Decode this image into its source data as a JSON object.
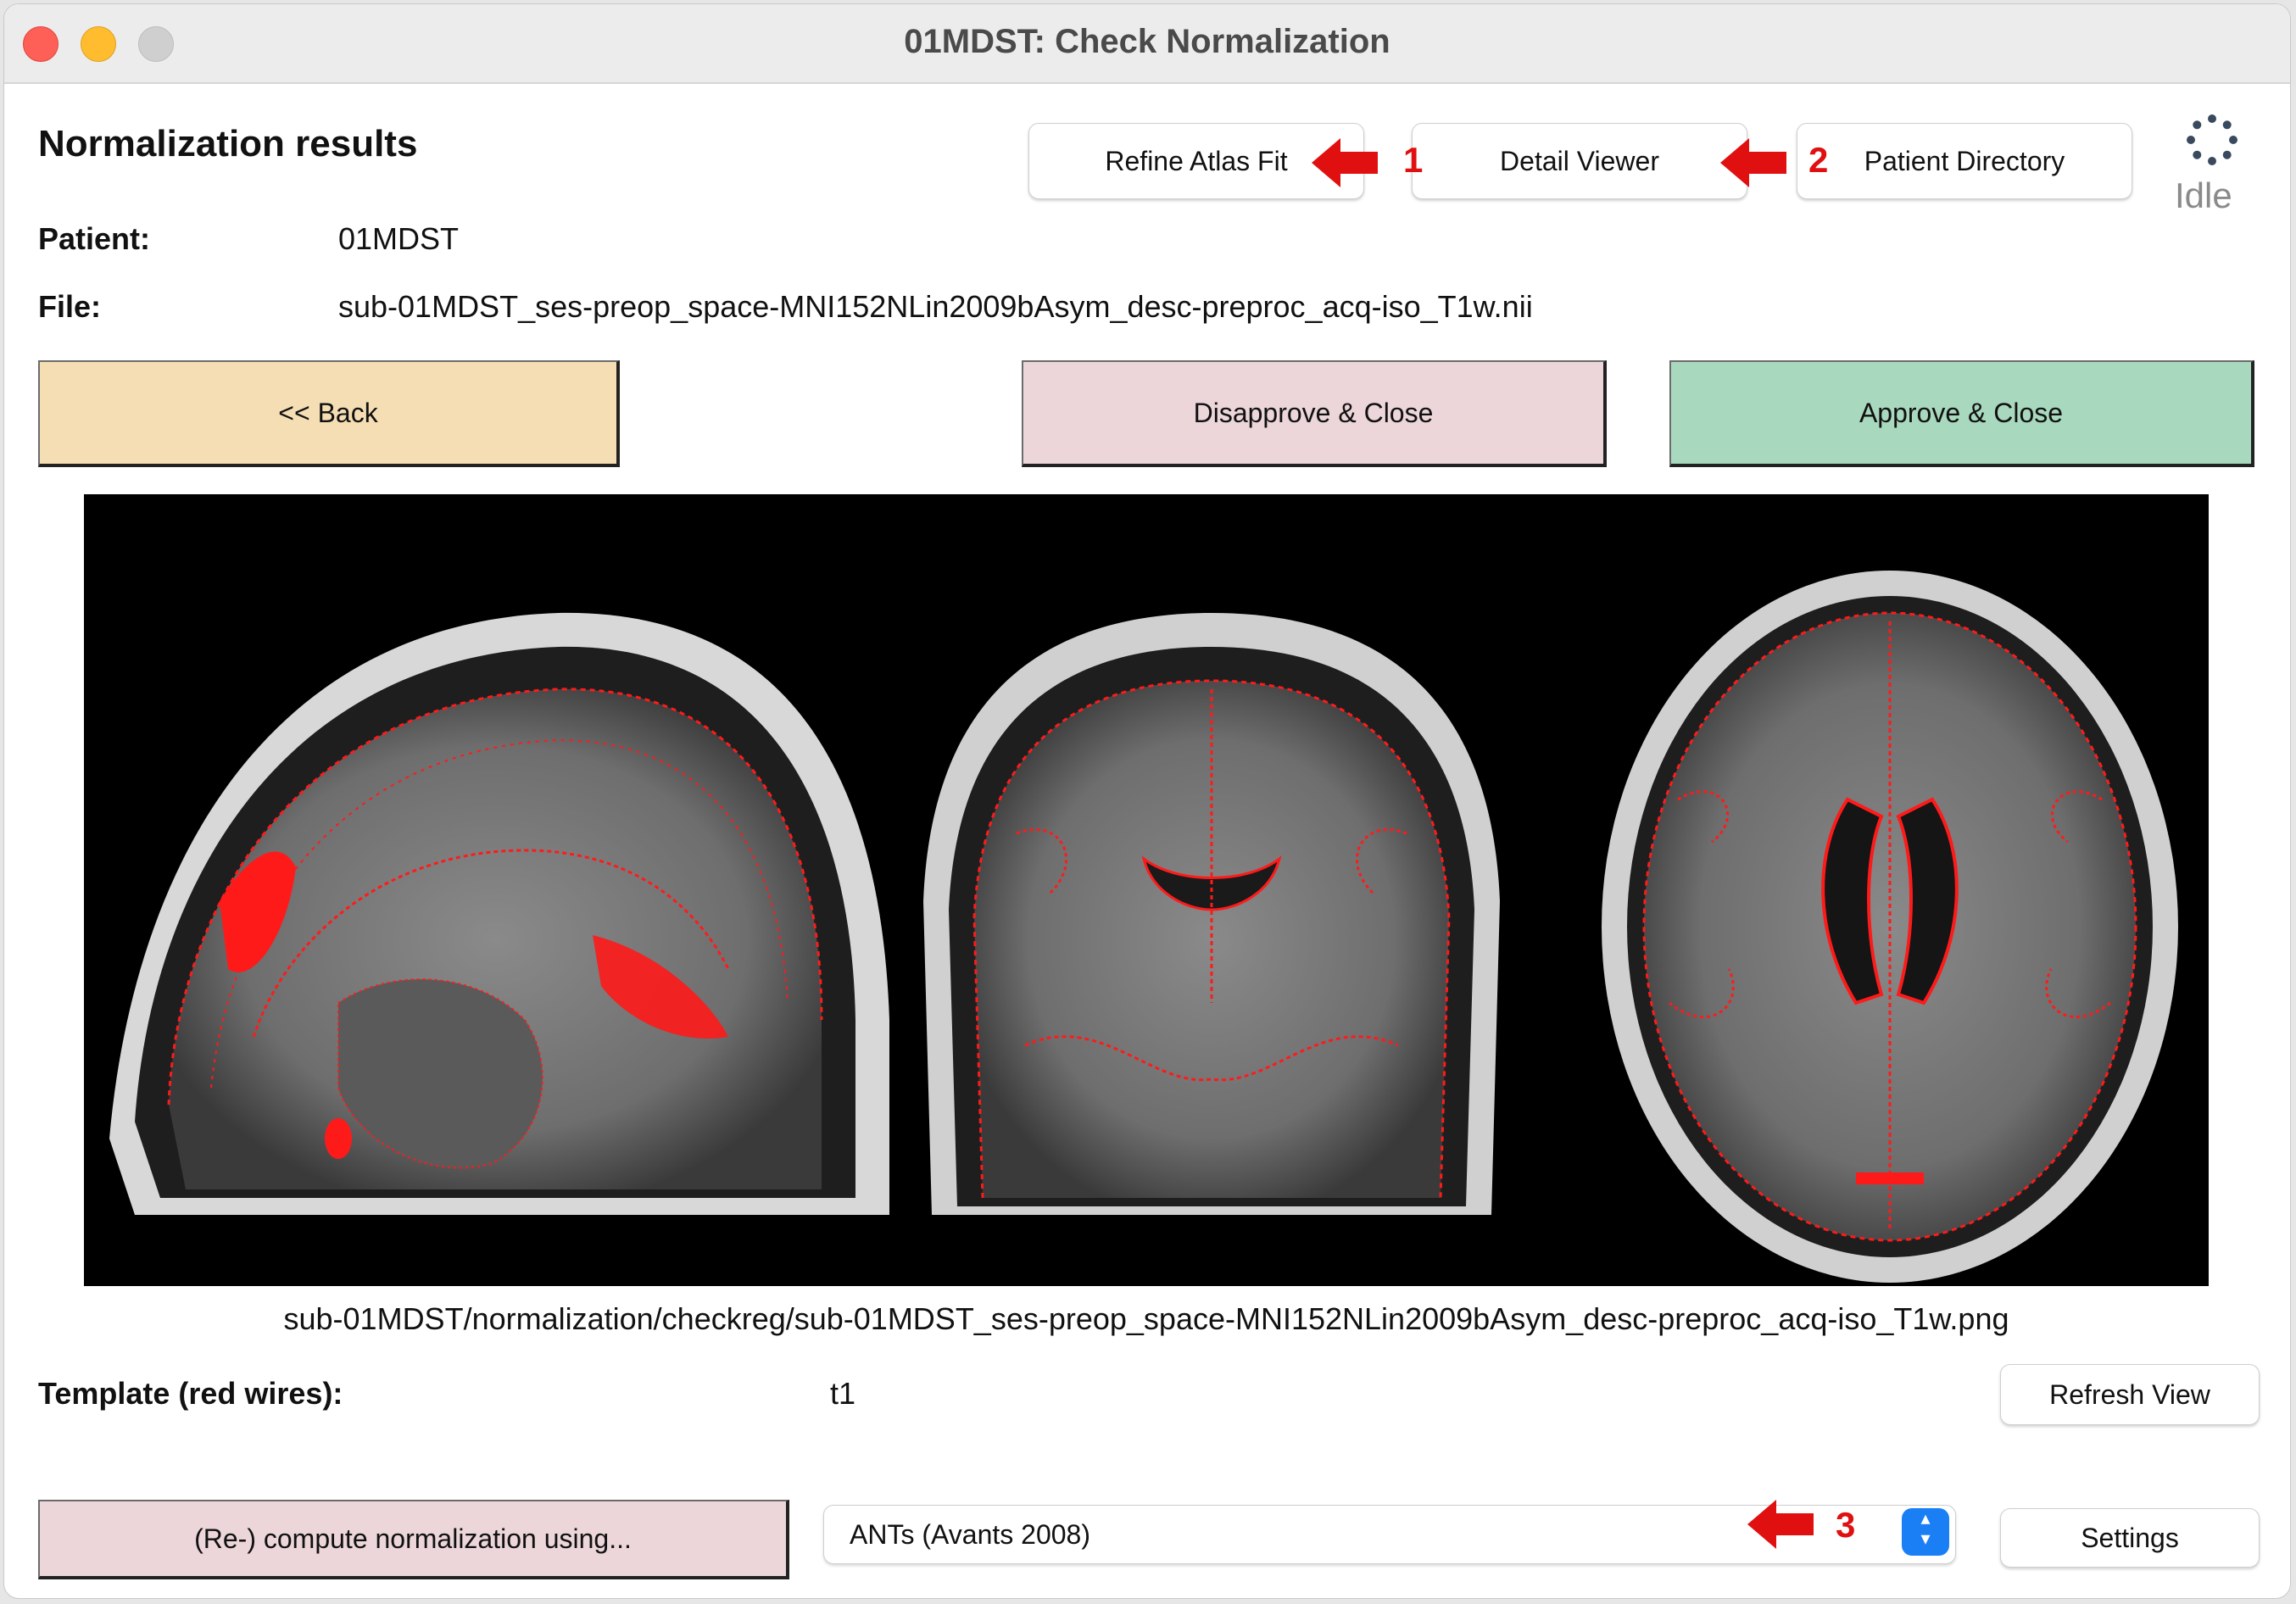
{
  "window": {
    "title": "01MDST: Check Normalization"
  },
  "header": {
    "heading": "Normalization results"
  },
  "patient": {
    "label": "Patient:",
    "value": "01MDST"
  },
  "file": {
    "label": "File:",
    "value": "sub-01MDST_ses-preop_space-MNI152NLin2009bAsym_desc-preproc_acq-iso_T1w.nii"
  },
  "toolbar": {
    "refine_label": "Refine Atlas Fit",
    "detail_label": "Detail Viewer",
    "patient_dir_label": "Patient Directory",
    "status": "Idle"
  },
  "annotations": {
    "one": "1",
    "two": "2",
    "three": "3"
  },
  "actions": {
    "back_label": "<< Back",
    "disapprove_label": "Disapprove & Close",
    "approve_label": "Approve & Close"
  },
  "image": {
    "caption": "sub-01MDST/normalization/checkreg/sub-01MDST_ses-preop_space-MNI152NLin2009bAsym_desc-preproc_acq-iso_T1w.png",
    "views": [
      "sagittal-slice",
      "coronal-slice",
      "axial-slice"
    ]
  },
  "template": {
    "label": "Template (red wires):",
    "value": "t1",
    "refresh_label": "Refresh View"
  },
  "compute": {
    "button_label": "(Re-) compute normalization using...",
    "method_selected": "ANTs (Avants 2008)",
    "settings_label": "Settings"
  },
  "colors": {
    "back": "#f5deb3",
    "disapprove": "#ecd6da",
    "approve": "#a8d8bd",
    "compute": "#ecd6da",
    "annotation_red": "#e01010",
    "wire_red": "#ff1a1a"
  }
}
